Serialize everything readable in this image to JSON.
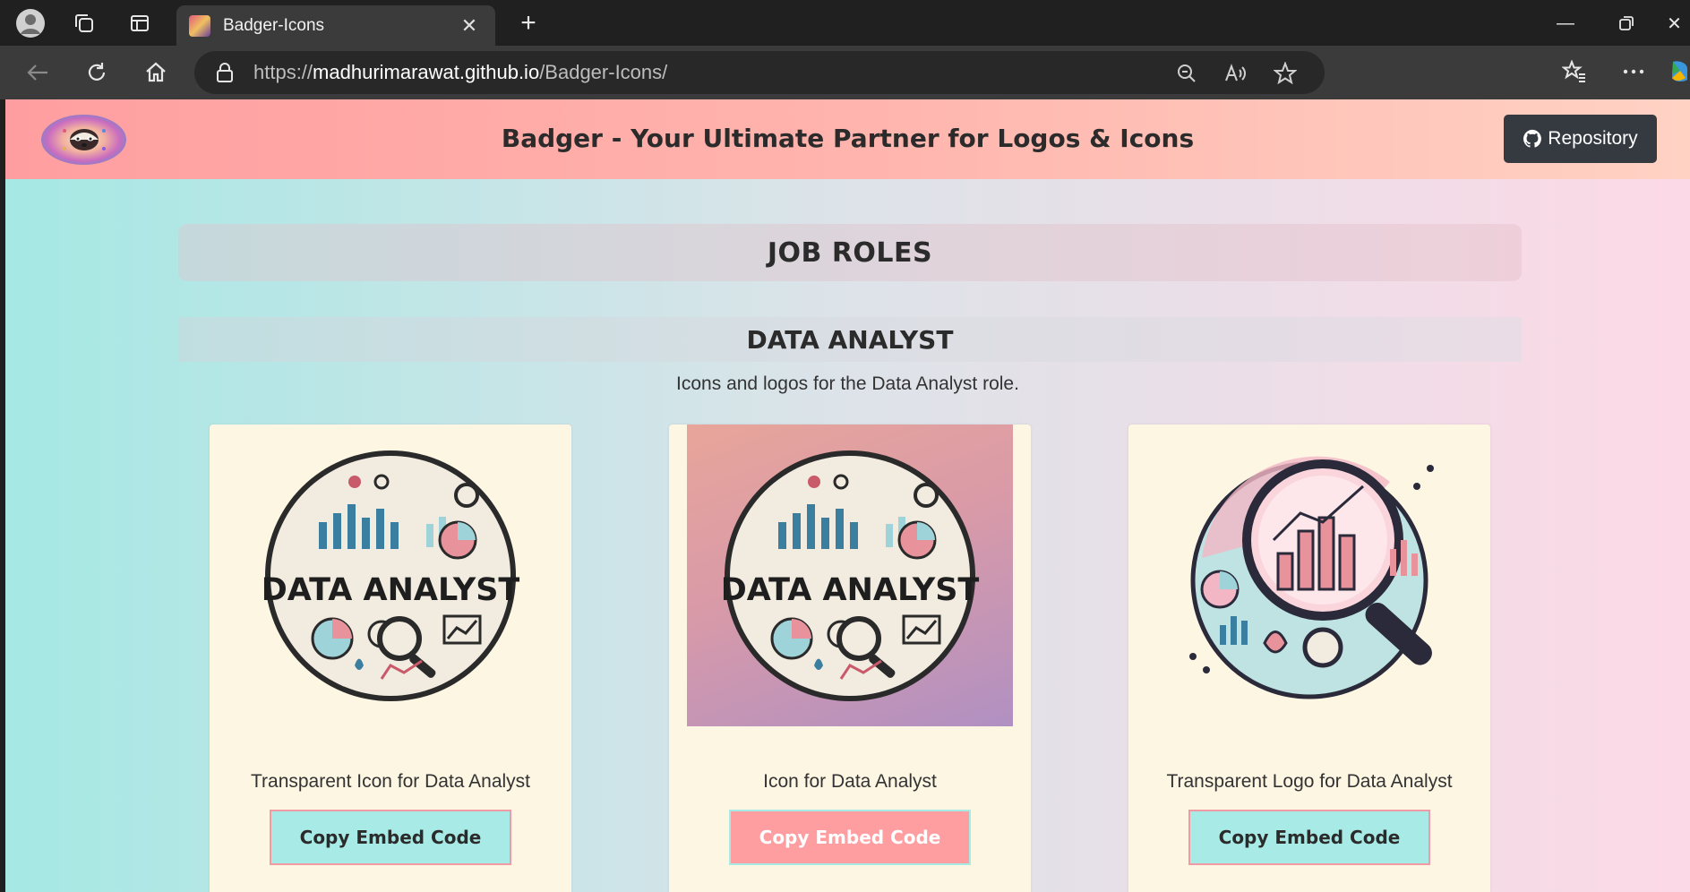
{
  "browser": {
    "tab_title": "Badger-Icons",
    "url_scheme": "https://",
    "url_host": "madhurimarawat.github.io",
    "url_path": "/Badger-Icons/"
  },
  "site": {
    "title": "Badger - Your Ultimate Partner for Logos & Icons",
    "repo_button": "Repository"
  },
  "section": {
    "title": "JOB ROLES"
  },
  "role": {
    "title": "DATA ANALYST",
    "description": "Icons and logos for the Data Analyst role."
  },
  "cards": [
    {
      "label": "Transparent Icon for Data Analyst",
      "button": "Copy Embed Code",
      "image_text": "DATA ANALYST"
    },
    {
      "label": "Icon for Data Analyst",
      "button": "Copy Embed Code",
      "image_text": "DATA ANALYST"
    },
    {
      "label": "Transparent Logo for Data Analyst",
      "button": "Copy Embed Code"
    }
  ],
  "colors": {
    "header_gradient_start": "#ff9ea0",
    "teal_button": "#a8ebe6",
    "pink_button": "#ff9ea0",
    "card_bg": "#fdf6e3",
    "repo_button_bg": "#343a40"
  }
}
